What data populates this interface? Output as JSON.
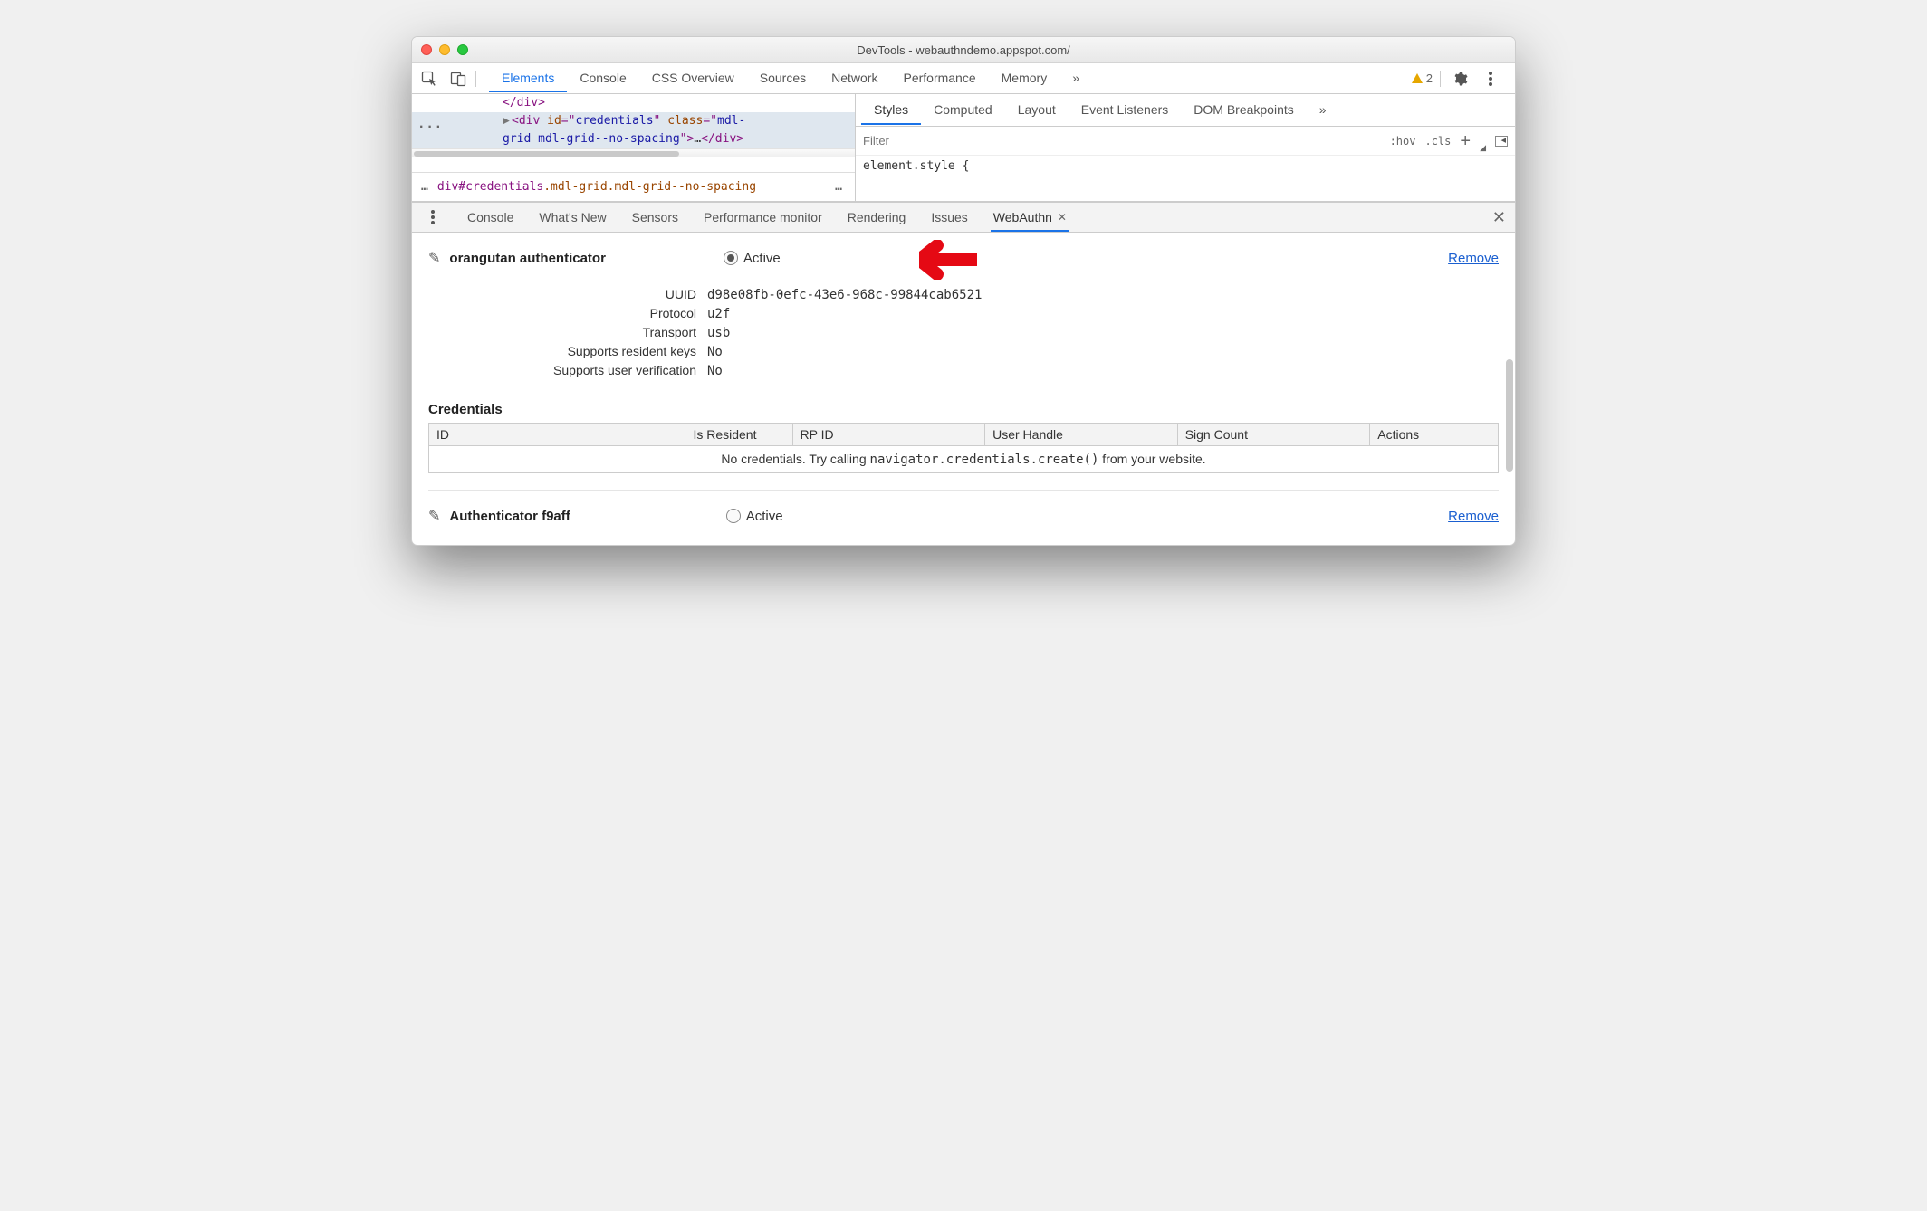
{
  "window": {
    "title": "DevTools - webauthndemo.appspot.com/"
  },
  "main_tabs": {
    "labels": [
      "Elements",
      "Console",
      "CSS Overview",
      "Sources",
      "Network",
      "Performance",
      "Memory"
    ],
    "active": 0,
    "overflow_glyph": "»",
    "warnings_count": "2"
  },
  "dom": {
    "line0": "</div>",
    "line1_id": "credentials",
    "line1_class": "mdl-grid mdl-grid--no-spacing",
    "breadcrumb_sel": "div#credentials",
    "breadcrumb_classes": ".mdl-grid.mdl-grid--no-spacing"
  },
  "styles_tabs": {
    "labels": [
      "Styles",
      "Computed",
      "Layout",
      "Event Listeners",
      "DOM Breakpoints"
    ],
    "active": 0,
    "overflow_glyph": "»"
  },
  "filter": {
    "placeholder": "Filter",
    "hov": ":hov",
    "cls": ".cls",
    "rule": "element.style {"
  },
  "drawer_tabs": {
    "labels": [
      "Console",
      "What's New",
      "Sensors",
      "Performance monitor",
      "Rendering",
      "Issues",
      "WebAuthn"
    ],
    "active": 6
  },
  "auth": {
    "edit_glyph": "✎",
    "name": "orangutan authenticator",
    "active_label": "Active",
    "remove_label": "Remove",
    "props": {
      "uuid_label": "UUID",
      "uuid_value": "d98e08fb-0efc-43e6-968c-99844cab6521",
      "protocol_label": "Protocol",
      "protocol_value": "u2f",
      "transport_label": "Transport",
      "transport_value": "usb",
      "rk_label": "Supports resident keys",
      "rk_value": "No",
      "uv_label": "Supports user verification",
      "uv_value": "No"
    }
  },
  "credentials": {
    "heading": "Credentials",
    "cols": {
      "id": "ID",
      "resident": "Is Resident",
      "rpid": "RP ID",
      "userhandle": "User Handle",
      "signcount": "Sign Count",
      "actions": "Actions"
    },
    "empty_prefix": "No credentials. Try calling ",
    "empty_code": "navigator.credentials.create()",
    "empty_suffix": " from your website."
  },
  "auth2": {
    "name": "Authenticator f9aff",
    "active_label": "Active",
    "remove_label": "Remove"
  }
}
